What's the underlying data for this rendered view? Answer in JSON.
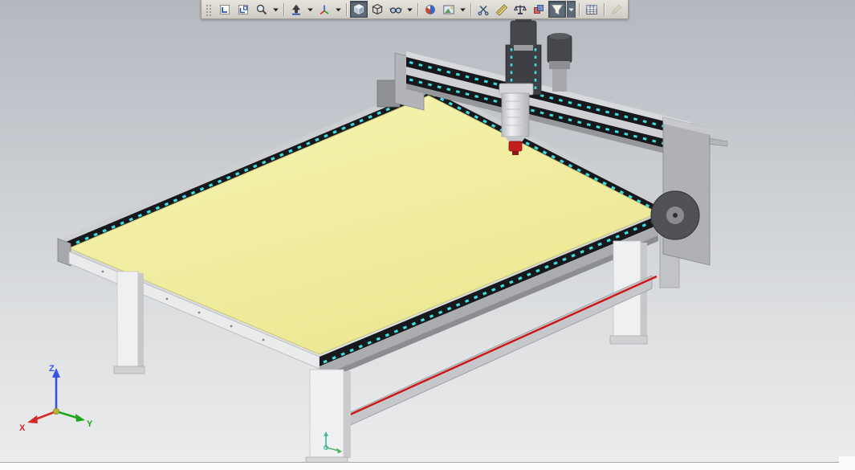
{
  "window": {
    "background_top": "#b4b8bf",
    "background_bottom": "#ecedee",
    "bottom_strip_color": "#fbfbfb"
  },
  "toolbar": {
    "background": "#d7d4cd",
    "pressed_color": "#5e6a77",
    "buttons": [
      {
        "name": "toolbar-grip-handle",
        "icon": "grip-icon"
      },
      {
        "name": "zoom-to-fit-button",
        "icon": "zoom-fit-icon"
      },
      {
        "name": "zoom-to-area-button",
        "icon": "zoom-area-icon"
      },
      {
        "name": "previous-view-button",
        "icon": "magnifier-icon",
        "dropdown": true
      },
      {
        "separator": true
      },
      {
        "name": "normal-to-button",
        "icon": "arrow-up-icon",
        "dropdown": true
      },
      {
        "name": "view-orientation-button",
        "icon": "triad-icon",
        "dropdown": true
      },
      {
        "separator": true
      },
      {
        "name": "display-style-shaded-button",
        "icon": "shaded-cube-icon",
        "state": "pressed"
      },
      {
        "name": "display-style-wireframe-button",
        "icon": "wireframe-cube-icon"
      },
      {
        "name": "hide-show-items-button",
        "icon": "glasses-icon",
        "dropdown": true
      },
      {
        "separator": true
      },
      {
        "name": "edit-appearance-button",
        "icon": "appearance-icon"
      },
      {
        "name": "apply-scene-button",
        "icon": "scene-icon",
        "dropdown": true
      },
      {
        "separator": true
      },
      {
        "name": "section-view-button",
        "icon": "scissors-icon"
      },
      {
        "name": "measure-button",
        "icon": "measure-icon"
      },
      {
        "name": "mass-properties-button",
        "icon": "mass-properties-icon"
      },
      {
        "name": "interference-check-button",
        "icon": "interference-icon"
      },
      {
        "name": "selection-filter-button",
        "icon": "funnel-icon",
        "state": "pressed",
        "dropdown": true
      },
      {
        "separator": true
      },
      {
        "name": "design-table-button",
        "icon": "table-icon"
      },
      {
        "separator": true
      },
      {
        "name": "edit-sketch-button",
        "icon": "pencil-icon",
        "state": "disabled"
      }
    ]
  },
  "viewport": {
    "triad": {
      "x_label": "X",
      "y_label": "Y",
      "z_label": "Z",
      "x_color": "#d42a2a",
      "y_color": "#1ea51e",
      "z_color": "#3653e8"
    }
  },
  "model": {
    "description": "CNC router machine 3D model",
    "bed_color": "#f2efa3",
    "rail_color": "#17181b",
    "rail_marker_color": "#3adfe3",
    "frame_color": "#b4b5b9",
    "leg_color": "#eff0f2",
    "spindle_collet_color": "#c41d1d",
    "accent_line_color": "#cc1515",
    "motor_color": "#46474b"
  }
}
